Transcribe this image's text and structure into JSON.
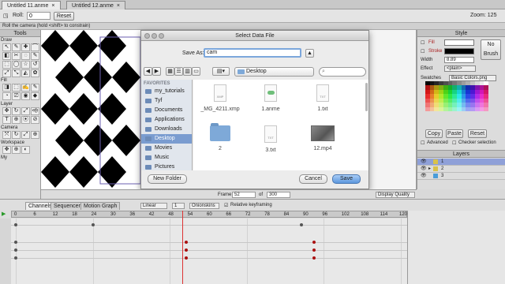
{
  "doc_tabs": [
    {
      "label": "Untitled 11.anme",
      "active": true
    },
    {
      "label": "Untitled 12.anme",
      "active": false
    }
  ],
  "toolbar": {
    "roll_label": "Roll:",
    "roll_value": "0",
    "reset_label": "Reset",
    "zoom_label": "Zoom: 125"
  },
  "hint": "Roll the camera (hold <shift> to constrain)",
  "tools": {
    "title": "Tools",
    "sections": [
      "Draw",
      "Fill",
      "Layer",
      "Camera",
      "Workspace",
      "My"
    ],
    "draw_icons": [
      "↖",
      "✎",
      "✚",
      "⌒",
      "◧",
      "✂",
      "◌",
      "✎",
      "⬚",
      "◯",
      "☆",
      "↺",
      "⤢",
      "⤡",
      "◭",
      "✿"
    ],
    "fill_icons": [
      "◨",
      "⬚",
      "✍",
      "✎",
      "◔",
      "⎚",
      "◉",
      "◆"
    ],
    "layer_icons": [
      "✥",
      "↻",
      "⤢",
      "⬲",
      "T",
      "⊕",
      "⦿",
      "⊘"
    ],
    "camera_icons": [
      "⤧",
      "↻",
      "⤢",
      "⊕"
    ],
    "workspace_icons": [
      "✥",
      "⊕",
      "◐"
    ]
  },
  "dialog": {
    "title": "Select Data File",
    "save_as_label": "Save As:",
    "save_as_value": "cam",
    "expand_label": "▲",
    "back_label": "◀",
    "forward_label": "▶",
    "location": "Desktop",
    "search_placeholder": "",
    "sidebar_heading": "FAVORITES",
    "sidebar_items": [
      {
        "label": "my_tutorials",
        "active": false
      },
      {
        "label": "Tyf",
        "active": false
      },
      {
        "label": "Documents",
        "active": false
      },
      {
        "label": "Applications",
        "active": false
      },
      {
        "label": "Downloads",
        "active": false
      },
      {
        "label": "Desktop",
        "active": true
      },
      {
        "label": "Movies",
        "active": false
      },
      {
        "label": "Music",
        "active": false
      },
      {
        "label": "Pictures",
        "active": false
      }
    ],
    "files": [
      {
        "label": "_MG_4211.xmp",
        "kind": "doc",
        "tag": "XMP"
      },
      {
        "label": "1.anme",
        "kind": "cloud",
        "tag": ""
      },
      {
        "label": "1.txt",
        "kind": "doc",
        "tag": "TXT"
      },
      {
        "label": "2",
        "kind": "folder",
        "tag": ""
      },
      {
        "label": "3.txt",
        "kind": "doc",
        "tag": "TXT"
      },
      {
        "label": "12.mp4",
        "kind": "image",
        "tag": ""
      }
    ],
    "new_folder_label": "New Folder",
    "cancel_label": "Cancel",
    "save_label": "Save"
  },
  "style": {
    "title": "Style",
    "fill_label": "Fill",
    "stroke_label": "Stroke",
    "width_label": "Width",
    "width_value": "8.89",
    "effect_label": "Effect",
    "effect_value": "<plain>",
    "no_brush_label": "No Brush",
    "swatches_label": "Swatches",
    "swatches_value": "Basic Colors.png",
    "copy_label": "Copy",
    "paste_label": "Paste",
    "reset_label": "Reset",
    "advanced_label": "Advanced",
    "checker_label": "Checker selection",
    "fill_color": "#ffffff",
    "stroke_color": "#000000"
  },
  "layers": {
    "title": "Layers",
    "items": [
      {
        "label": "1",
        "selected": true
      },
      {
        "label": "2",
        "selected": false
      },
      {
        "label": "3",
        "selected": false
      }
    ]
  },
  "framebar": {
    "frame_label": "Frame",
    "frame_value": "52",
    "of_label": "of",
    "total_value": "300",
    "quality_label": "Display Quality"
  },
  "timeline": {
    "tabs": [
      {
        "label": "Channels",
        "active": true
      },
      {
        "label": "Sequencer",
        "active": false
      },
      {
        "label": "Motion Graph",
        "active": false
      }
    ],
    "interp_value": "Linear",
    "step_value": "1",
    "onionskins_label": "Onionskins",
    "relative_label": "Relative keyframing",
    "ticks": [
      "0",
      "6",
      "12",
      "18",
      "24",
      "30",
      "36",
      "42",
      "48",
      "54",
      "60",
      "66",
      "72",
      "78",
      "84",
      "90",
      "96",
      "102",
      "108",
      "114",
      "120"
    ],
    "current_frame": 52,
    "tracks": [
      {
        "keys": [
          {
            "frame": 0,
            "color": "#555555"
          },
          {
            "frame": 24,
            "color": "#555555"
          },
          {
            "frame": 89,
            "color": "#555555"
          }
        ]
      },
      {
        "keys": [
          {
            "frame": 0,
            "color": "#555555"
          },
          {
            "frame": 53,
            "color": "#aa1111"
          },
          {
            "frame": 93,
            "color": "#aa1111"
          }
        ]
      },
      {
        "keys": [
          {
            "frame": 0,
            "color": "#555555"
          },
          {
            "frame": 53,
            "color": "#aa1111"
          },
          {
            "frame": 93,
            "color": "#aa1111"
          }
        ]
      },
      {
        "keys": [
          {
            "frame": 0,
            "color": "#555555"
          },
          {
            "frame": 53,
            "color": "#aa1111"
          },
          {
            "frame": 93,
            "color": "#aa1111"
          }
        ]
      }
    ]
  }
}
